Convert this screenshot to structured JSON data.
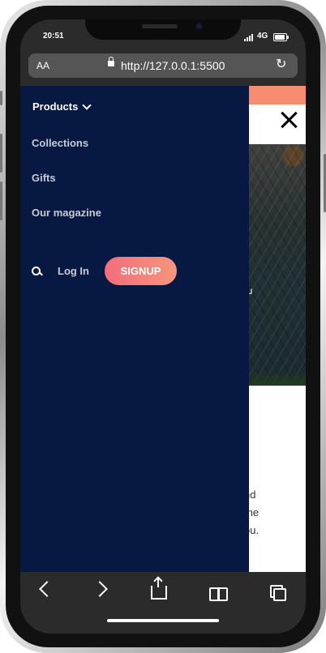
{
  "status": {
    "time": "20:51",
    "network": "4G"
  },
  "browser": {
    "text_size": "AA",
    "url": "http://127.0.0.1:5500"
  },
  "menu": {
    "products": "Products",
    "collections": "Collections",
    "gifts": "Gifts",
    "magazine": "Our magazine",
    "login": "Log In",
    "signup": "SIGNUP"
  },
  "background": {
    "image_text": "ou",
    "paragraph_lines": [
      "nd",
      "the",
      "ou."
    ]
  },
  "icons": [
    "search-icon",
    "chevron-down-icon",
    "close-icon",
    "lock-icon",
    "reload-icon",
    "back-icon",
    "forward-icon",
    "share-icon",
    "bookmarks-icon",
    "tabs-icon"
  ],
  "colors": {
    "drawer": "#071943",
    "signup": "#f7877b",
    "banner": "#f88c70",
    "toolbar": "#2b2b2b"
  }
}
